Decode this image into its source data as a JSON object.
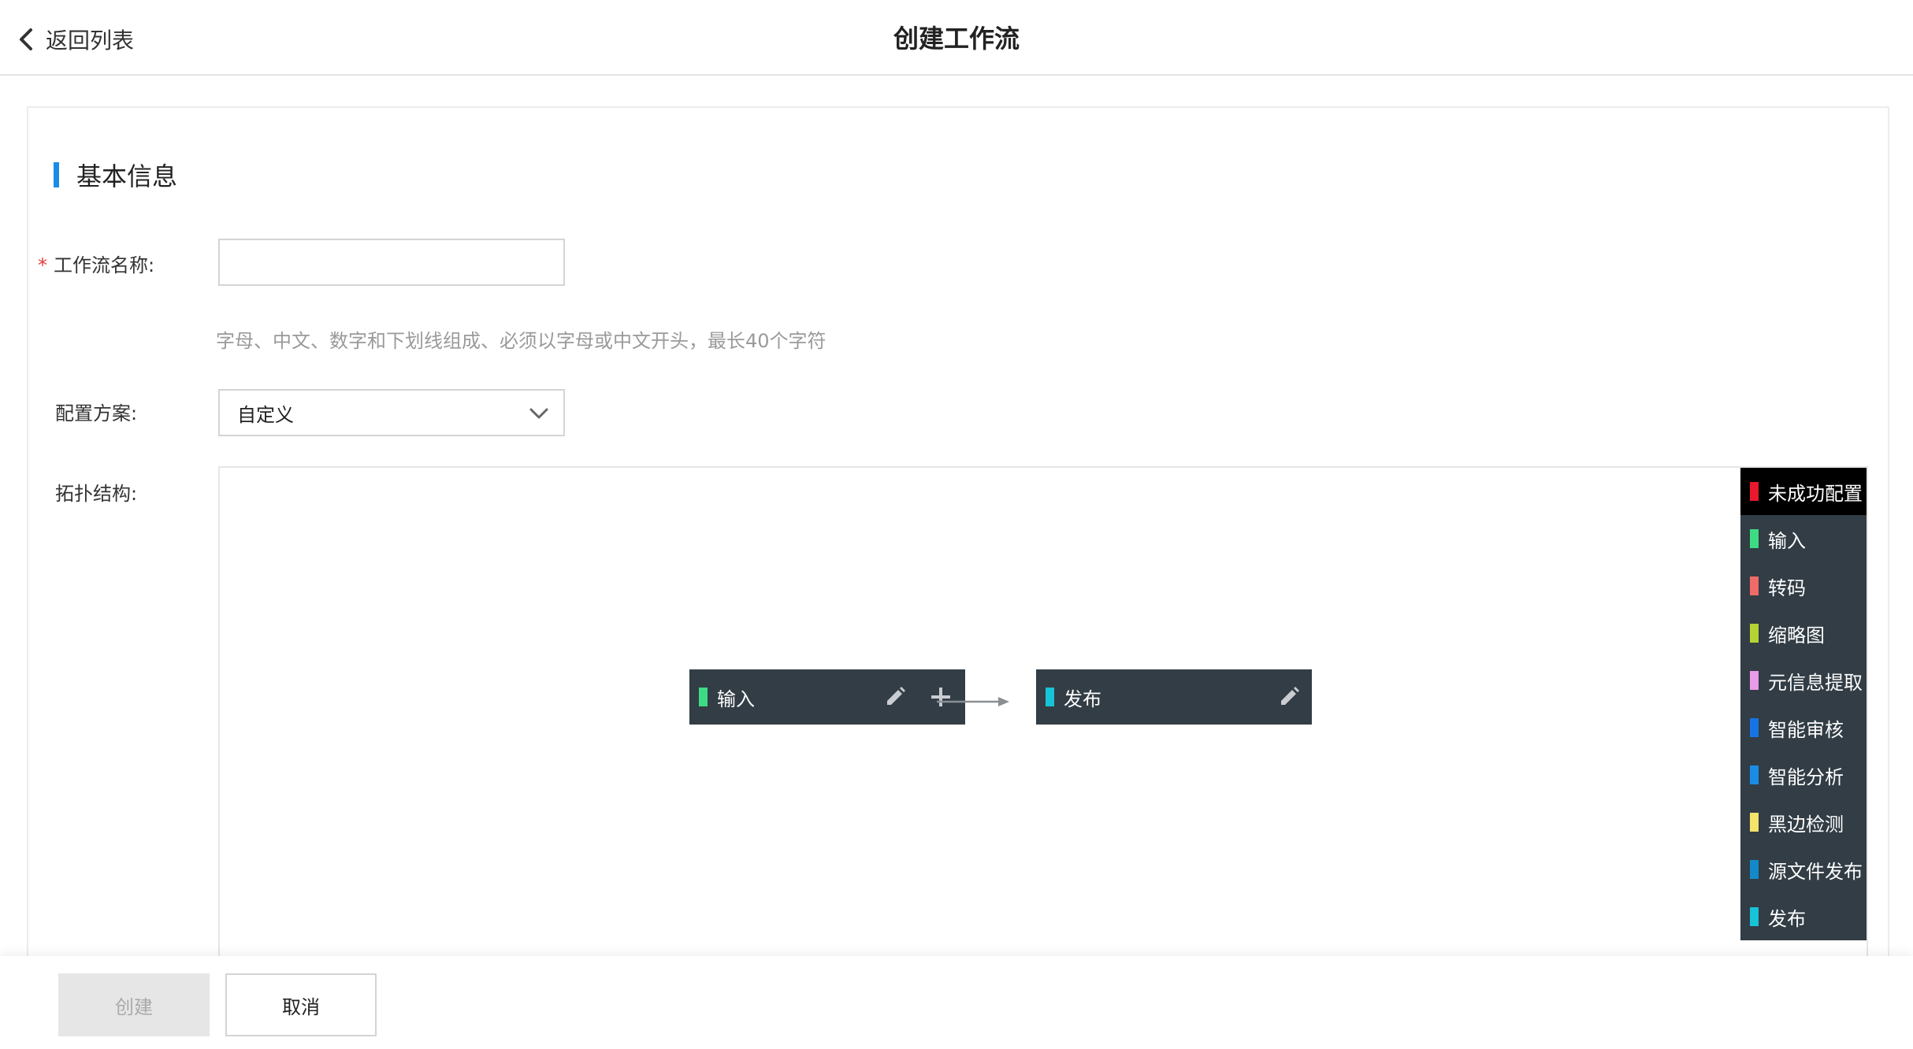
{
  "header": {
    "back_label": "返回列表",
    "title": "创建工作流"
  },
  "section": {
    "title": "基本信息"
  },
  "form": {
    "name_required_mark": "*",
    "name_label": "工作流名称:",
    "name_value": "",
    "name_hint": "字母、中文、数字和下划线组成、必须以字母或中文开头，最长40个字符",
    "scheme_label": "配置方案:",
    "scheme_value": "自定义",
    "topology_label": "拓扑结构:"
  },
  "topology": {
    "nodes": [
      {
        "label": "输入",
        "color": "#3ddc84",
        "actions": [
          "pencil-icon",
          "plus-icon"
        ]
      },
      {
        "label": "发布",
        "color": "#17c3d6",
        "actions": [
          "pencil-icon"
        ]
      }
    ],
    "legend": [
      {
        "label": "未成功配置",
        "color": "#e8192c",
        "active": true
      },
      {
        "label": "输入",
        "color": "#3ddc84"
      },
      {
        "label": "转码",
        "color": "#f06a6a"
      },
      {
        "label": "缩略图",
        "color": "#b5d334"
      },
      {
        "label": "元信息提取",
        "color": "#e79be8"
      },
      {
        "label": "智能审核",
        "color": "#1674e6"
      },
      {
        "label": "智能分析",
        "color": "#1a8ce6"
      },
      {
        "label": "黑边检测",
        "color": "#f5e36a"
      },
      {
        "label": "源文件发布",
        "color": "#1389c9"
      },
      {
        "label": "发布",
        "color": "#17c3d6"
      }
    ]
  },
  "footer": {
    "create_label": "创建",
    "cancel_label": "取消"
  }
}
